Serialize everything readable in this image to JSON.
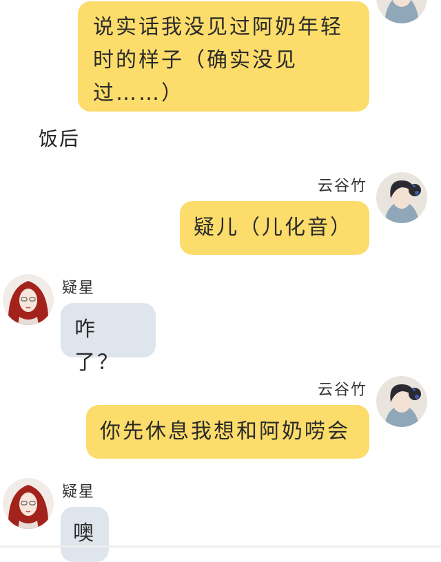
{
  "messages": {
    "m1": {
      "text": "说实话我没见过阿奶年轻时的样子（确实没见过……）"
    },
    "narration": {
      "text": "饭后"
    },
    "m2": {
      "sender": "云谷竹",
      "text": "疑儿（儿化音）"
    },
    "m3": {
      "sender": "疑星",
      "text": "咋了？"
    },
    "m4": {
      "sender": "云谷竹",
      "text": "你先休息我想和阿奶唠会"
    },
    "m5": {
      "sender": "疑星",
      "text": "噢"
    }
  },
  "colors": {
    "my_bubble": "#fcdc6a",
    "their_bubble": "#dfe5ec",
    "background": "#ffffff"
  },
  "icons": {
    "my_avatar": "dark-haired-girl-avatar",
    "their_avatar": "red-haired-girl-avatar"
  }
}
